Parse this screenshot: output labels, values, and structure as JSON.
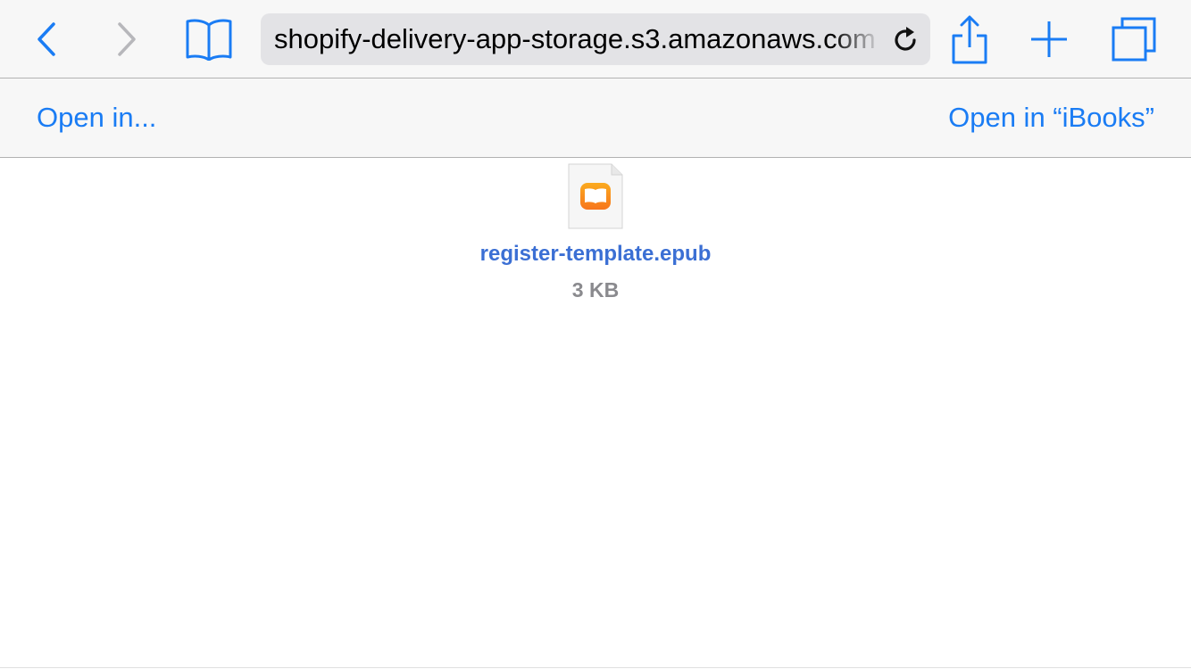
{
  "toolbar": {
    "back_icon": "back-chevron-icon",
    "forward_icon": "forward-chevron-icon",
    "bookmarks_icon": "book-icon",
    "share_icon": "share-icon",
    "new_tab_icon": "plus-icon",
    "tabs_icon": "tabs-icon",
    "address": {
      "url": "shopify-delivery-app-storage.s3.amazonaws.com",
      "reload_icon": "reload-icon"
    }
  },
  "subbar": {
    "open_in": "Open in...",
    "open_in_app": "Open in “iBooks”"
  },
  "file": {
    "icon": "ibooks-document-icon",
    "name": "register-template.epub",
    "size": "3 KB"
  },
  "colors": {
    "accent": "#1a7cf4",
    "toolbar_bg": "#f7f7f7",
    "address_bg": "#e3e3e6",
    "file_link": "#3b6fd4",
    "ibooks_orange": "#fb8c1c"
  }
}
